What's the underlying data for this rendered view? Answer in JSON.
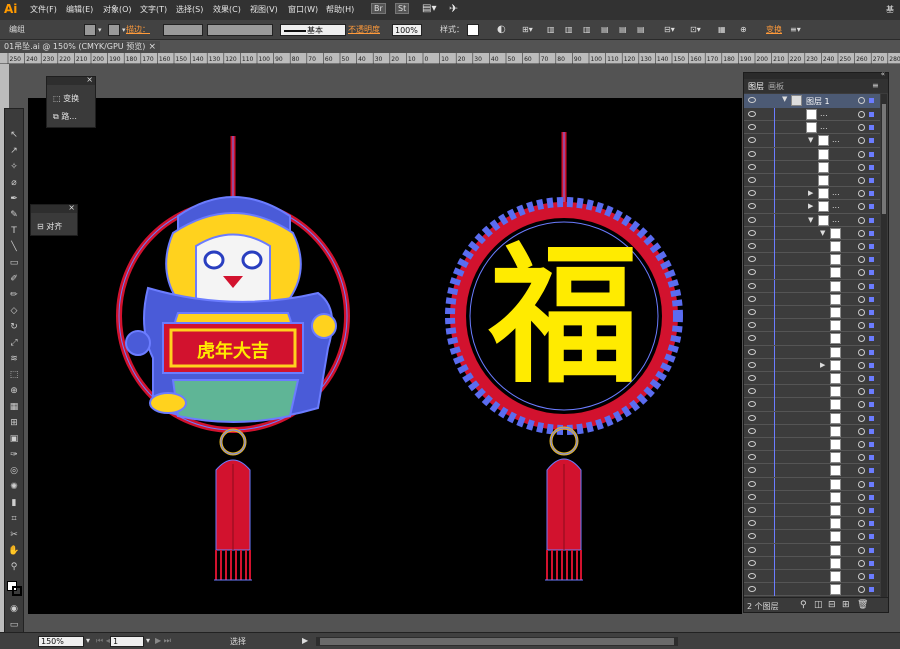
{
  "app": {
    "logo": "Ai",
    "right_text": "基"
  },
  "menu": [
    "文件(F)",
    "编辑(E)",
    "对象(O)",
    "文字(T)",
    "选择(S)",
    "效果(C)",
    "视图(V)",
    "窗口(W)",
    "帮助(H)"
  ],
  "menu_badges": [
    "Br",
    "St"
  ],
  "control": {
    "group_label": "编组",
    "stroke_label": "描边：",
    "stroke_style": "基本",
    "opacity_label": "不透明度",
    "opacity_value": "100%",
    "style_label": "样式：",
    "transform_label": "变换"
  },
  "document_tab": "01吊坠.ai @ 150% (CMYK/GPU 预览)",
  "ruler_ticks": [
    "250",
    "240",
    "230",
    "220",
    "210",
    "200",
    "190",
    "180",
    "170",
    "160",
    "150",
    "140",
    "130",
    "120",
    "110",
    "100",
    "90",
    "80",
    "70",
    "60",
    "50",
    "40",
    "30",
    "20",
    "10",
    "0",
    "10",
    "20",
    "30",
    "40",
    "50",
    "60",
    "70",
    "80",
    "90",
    "100",
    "110",
    "120",
    "130",
    "140",
    "150",
    "160",
    "170",
    "180",
    "190",
    "200",
    "210",
    "220",
    "230",
    "240",
    "250",
    "260",
    "270",
    "280"
  ],
  "floating_panels": {
    "transform_panel": [
      {
        "icon": "transform-icon",
        "label": "变换"
      },
      {
        "icon": "pathfinder-icon",
        "label": "路..."
      }
    ],
    "align_panel": [
      {
        "icon": "align-icon",
        "label": "对齐"
      }
    ]
  },
  "artwork": {
    "fu_character": "福",
    "banner_text": "虎年大吉"
  },
  "colors": {
    "red": "#d2122e",
    "yellow": "#ffeb00",
    "blue": "#5a6cf0",
    "path": "#6b7cff",
    "gold": "#e8b820"
  },
  "layers_panel": {
    "tabs": [
      "图层",
      "画板"
    ],
    "top_layer": "图层 1",
    "rows": [
      {
        "dots": "...",
        "expander": ""
      },
      {
        "dots": "...",
        "expander": ""
      },
      {
        "dots": "...",
        "expander": "▼"
      },
      {
        "dots": "",
        "expander": ""
      },
      {
        "dots": "",
        "expander": ""
      },
      {
        "dots": "",
        "expander": ""
      },
      {
        "dots": "...",
        "expander": "▶"
      },
      {
        "dots": "...",
        "expander": "▶"
      },
      {
        "dots": "...",
        "expander": "▼"
      },
      {
        "dots": "",
        "expander": "▼"
      },
      {
        "dots": "",
        "expander": ""
      },
      {
        "dots": "",
        "expander": ""
      },
      {
        "dots": "",
        "expander": ""
      },
      {
        "dots": "",
        "expander": ""
      },
      {
        "dots": "",
        "expander": ""
      },
      {
        "dots": "",
        "expander": ""
      },
      {
        "dots": "",
        "expander": ""
      },
      {
        "dots": "",
        "expander": ""
      },
      {
        "dots": "",
        "expander": ""
      },
      {
        "dots": "",
        "expander": "▶"
      },
      {
        "dots": "",
        "expander": ""
      },
      {
        "dots": "",
        "expander": ""
      },
      {
        "dots": "",
        "expander": ""
      },
      {
        "dots": "",
        "expander": ""
      },
      {
        "dots": "",
        "expander": ""
      },
      {
        "dots": "",
        "expander": ""
      },
      {
        "dots": "",
        "expander": ""
      },
      {
        "dots": "",
        "expander": ""
      },
      {
        "dots": "",
        "expander": ""
      },
      {
        "dots": "",
        "expander": ""
      },
      {
        "dots": "",
        "expander": ""
      },
      {
        "dots": "",
        "expander": ""
      },
      {
        "dots": "",
        "expander": ""
      },
      {
        "dots": "",
        "expander": ""
      },
      {
        "dots": "",
        "expander": ""
      },
      {
        "dots": "",
        "expander": ""
      },
      {
        "dots": "",
        "expander": ""
      }
    ],
    "footer": "2 个图层"
  },
  "status": {
    "zoom": "150%",
    "page": "1",
    "mode": "选择"
  }
}
